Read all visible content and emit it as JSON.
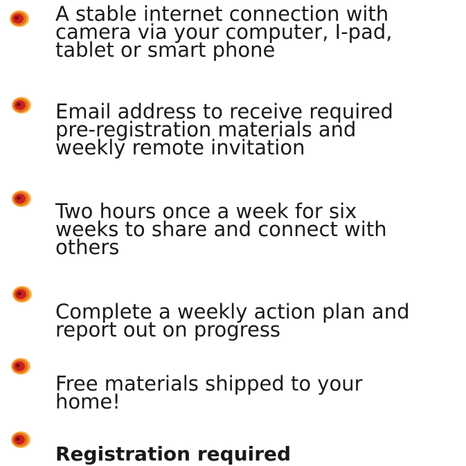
{
  "accent": {
    "outer": "#e8711c",
    "inner": "#c8201e",
    "highlight": "#f7b24a"
  },
  "bullet_icon": "orange-swirl-bullet-icon",
  "items": [
    {
      "lines": [
        "A stable internet connection with",
        "camera via your computer, I-pad,",
        "tablet or smart phone"
      ]
    },
    {
      "lines": [
        "Email address to receive required",
        "pre-registration materials and",
        "weekly remote invitation"
      ]
    },
    {
      "lines": [
        "Two hours once a week for six",
        "weeks to share and connect with",
        "others"
      ]
    },
    {
      "lines": [
        "Complete a weekly action plan and",
        "report out on progress"
      ]
    },
    {
      "lines": [
        "Free materials shipped to your",
        "home!"
      ]
    },
    {
      "lines": [
        "Registration required"
      ]
    }
  ]
}
